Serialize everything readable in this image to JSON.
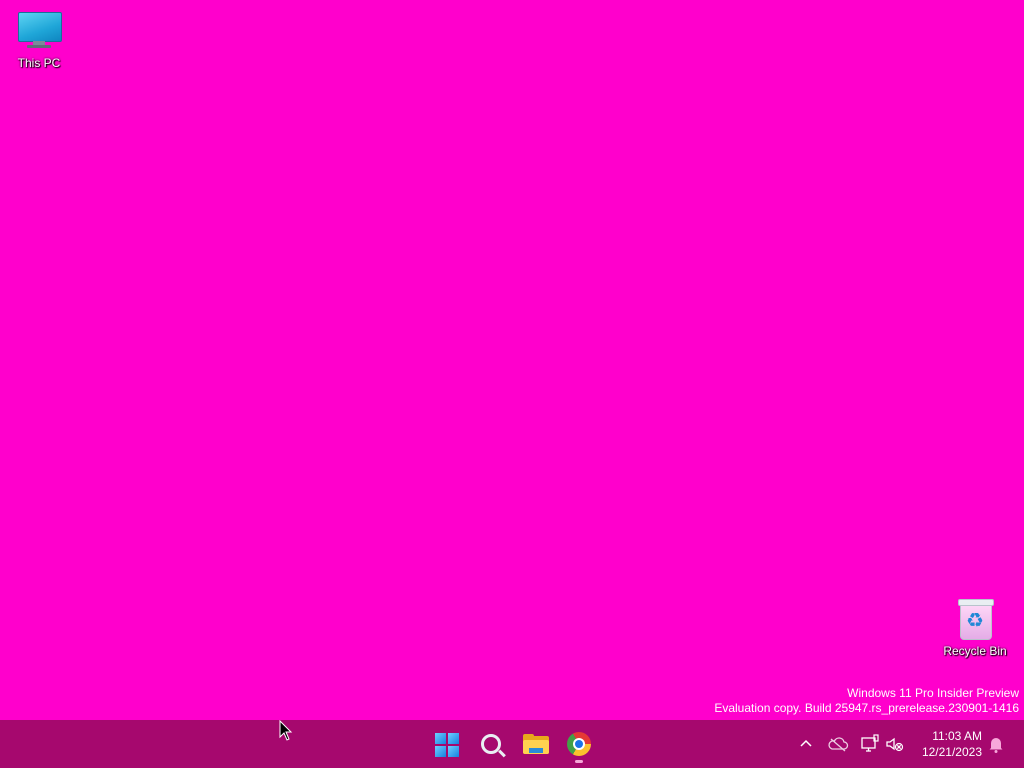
{
  "desktop": {
    "background_color": "#ff00cc",
    "icons": [
      {
        "label": "This PC",
        "icon": "this-pc-icon"
      },
      {
        "label": "Recycle Bin",
        "icon": "recycle-bin-icon"
      }
    ]
  },
  "watermark": {
    "line1": "Windows 11 Pro Insider Preview",
    "line2": "Evaluation copy. Build 25947.rs_prerelease.230901-1416"
  },
  "taskbar": {
    "background_color": "#a6086e",
    "pinned": [
      {
        "name": "Start",
        "icon": "windows-start-icon"
      },
      {
        "name": "Search",
        "icon": "search-icon"
      },
      {
        "name": "File Explorer",
        "icon": "folder-icon"
      },
      {
        "name": "Google Chrome",
        "icon": "chrome-icon",
        "running": true
      }
    ],
    "tray": {
      "icons": [
        "chevron-up-icon",
        "onedrive-cloud-icon",
        "network-icon",
        "volume-muted-icon",
        "notification-bell-icon"
      ],
      "time": "11:03 AM",
      "date": "12/21/2023"
    }
  }
}
